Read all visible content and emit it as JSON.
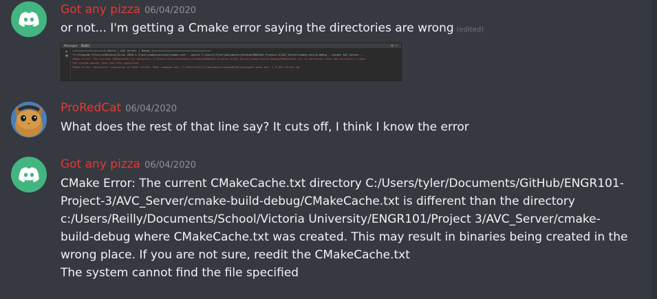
{
  "messages": [
    {
      "username": "Got any pizza",
      "timestamp": "06/04/2020",
      "text": "or not... I'm getting a Cmake error saying the directories are wrong",
      "edited_label": "(edited)",
      "avatar_icon": "discord-logo-icon",
      "attachment": {
        "tabs": [
          "Messages",
          "Build"
        ],
        "lines": [
          "====================[ Build | AVC_Server | Debug ]====================================",
          "\"C:\\Program Files\\JetBrains\\CLion 2020.1.2\\bin\\cmake\\win\\bin\\cmake.exe\" --build C:\\Users\\Tyler\\Documents\\GitHub\\ENGR101-Project-3\\AVC_Server\\cmake-build-debug --target AVC_Server --",
          "CMake Error: The current CMakeCache.txt directory C:/Users/tyler/Documents/GitHub/ENGR101-Project-3/AVC_Server/cmake-build-debug/CMakeCache.txt is different than the directory c:/Use",
          "The system cannot find the file specified",
          "CMake Error: Generator: execution of make failed. Make command was: C:/Users/Reilly/Documents/mingw64/bin/mingw32-make.exe -j 8 AVC_Server &&"
        ]
      }
    },
    {
      "username": "ProRedCat",
      "timestamp": "06/04/2020",
      "text": "What does the rest of that line say? It cuts off, I think I know the error",
      "avatar_icon": "cat-avatar-icon"
    },
    {
      "username": "Got any pizza",
      "timestamp": "06/04/2020",
      "lines": [
        "CMake Error: The current CMakeCache.txt directory C:/Users/tyler/Documents/GitHub/ENGR101-",
        "Project-3/AVC_Server/cmake-build-debug/CMakeCache.txt is different than the directory",
        "c:/Users/Reilly/Documents/School/Victoria University/ENGR101/Project 3/AVC_Server/cmake-",
        "build-debug where CMakeCache.txt was created. This may result in binaries being created in the",
        "wrong place. If you are not sure, reedit the CMakeCache.txt",
        "The system cannot find the file specified"
      ],
      "avatar_icon": "discord-logo-icon"
    }
  ],
  "colors": {
    "background": "#36393f",
    "username": "#e53935",
    "timestamp": "#8e9297",
    "text": "#dcddde",
    "discord_green": "#43b581"
  }
}
